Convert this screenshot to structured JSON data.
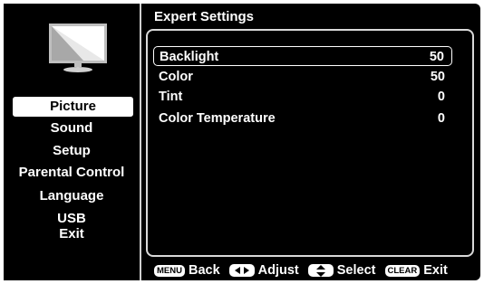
{
  "header": {
    "title": "Expert Settings"
  },
  "sidebar": {
    "items": [
      {
        "label": "Picture",
        "selected": true
      },
      {
        "label": "Sound"
      },
      {
        "label": "Setup"
      },
      {
        "label": "Parental Control"
      },
      {
        "label": "Language"
      },
      {
        "label": "USB"
      },
      {
        "label": "Exit"
      }
    ]
  },
  "settings": [
    {
      "label": "Backlight",
      "value": "50",
      "selected": true
    },
    {
      "label": "Color",
      "value": "50"
    },
    {
      "label": "Tint",
      "value": "0"
    },
    {
      "label": "Color Temperature",
      "value": "0"
    }
  ],
  "footer": {
    "menu_key": "MENU",
    "back_label": "Back",
    "adjust_label": "Adjust",
    "select_label": "Select",
    "clear_key": "CLEAR",
    "exit_label": "Exit"
  },
  "colors": {
    "background": "#000000",
    "text": "#ffffff",
    "highlight": "#ffffff"
  }
}
